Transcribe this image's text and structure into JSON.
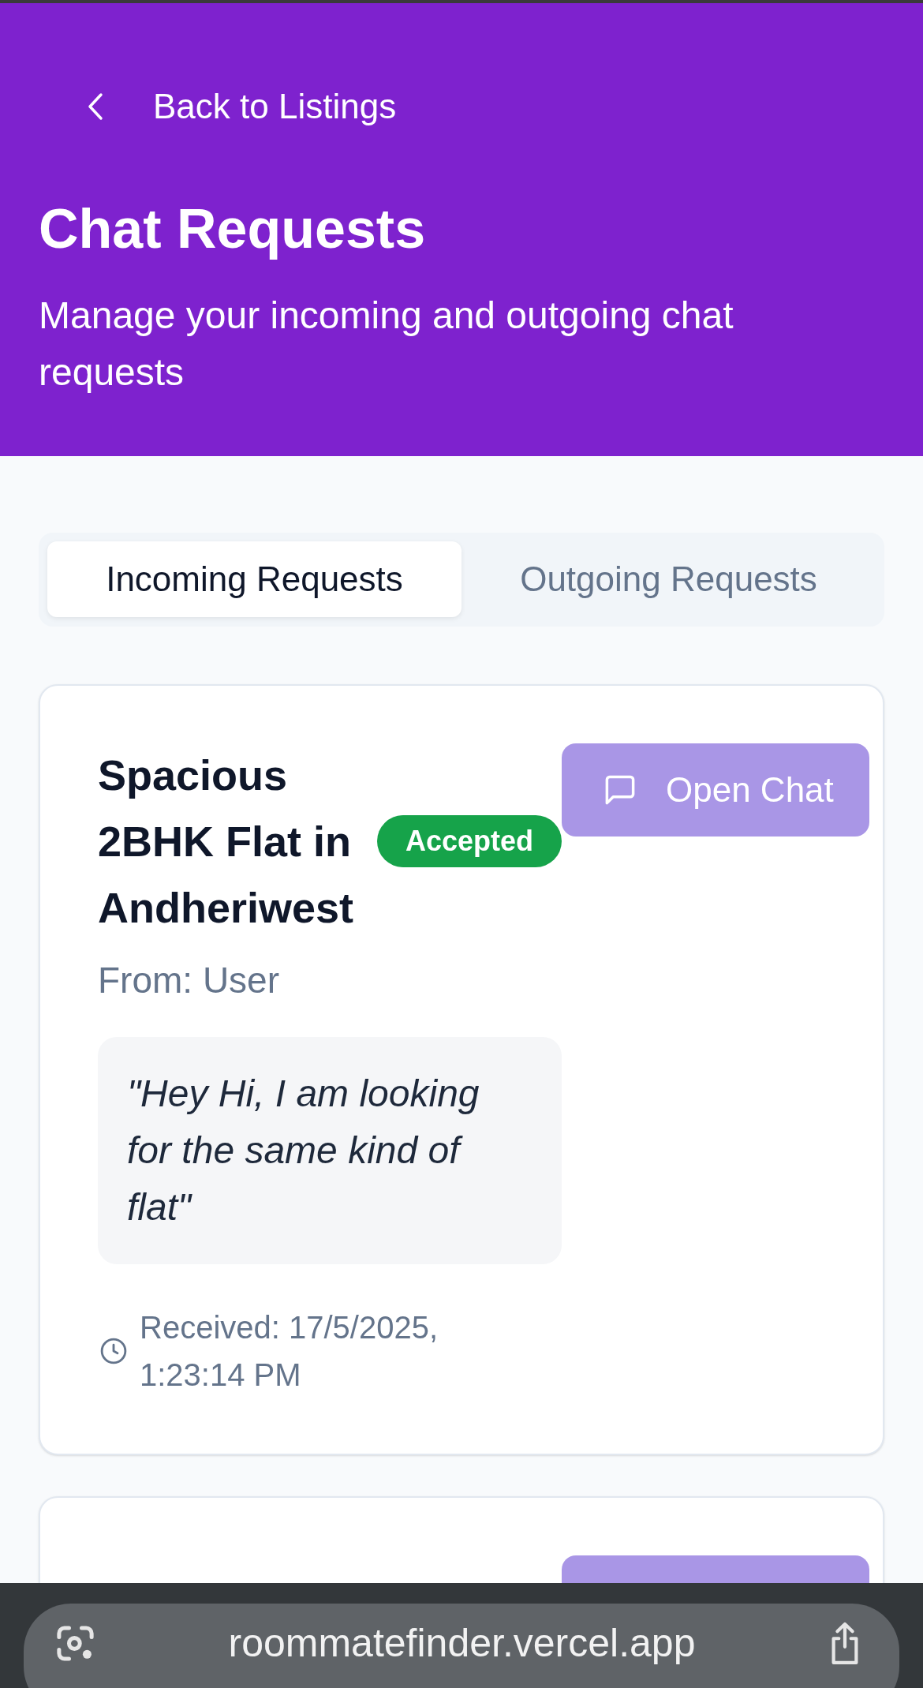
{
  "header": {
    "back_link": "Back to Listings",
    "title": "Chat Requests",
    "subtitle": "Manage your incoming and outgoing chat requests"
  },
  "tabs": [
    {
      "label": "Incoming Requests",
      "selected": true
    },
    {
      "label": "Outgoing Requests",
      "selected": false
    }
  ],
  "requests": [
    {
      "title": "Spacious 2BHK Flat in Andheriwest",
      "status": {
        "label": "Accepted",
        "color": "#16a34a"
      },
      "has_button": true,
      "button_label": "Open Chat",
      "from": "From: User",
      "message": "\"Hey Hi, I am looking for the same kind of flat\"",
      "received": "Received: 17/5/2025, 1:23:14 PM"
    },
    {
      "has_button": true
    }
  ],
  "browser_bar": {
    "url": "roommatefinder.vercel.app"
  }
}
